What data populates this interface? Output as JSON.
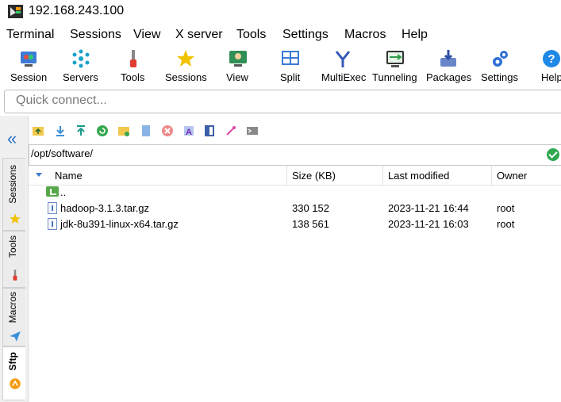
{
  "window": {
    "title": "192.168.243.100"
  },
  "menu": [
    "Terminal",
    "Sessions",
    "View",
    "X server",
    "Tools",
    "Settings",
    "Macros",
    "Help"
  ],
  "toolbar": [
    {
      "label": "Session",
      "icon": "session-icon"
    },
    {
      "label": "Servers",
      "icon": "servers-icon"
    },
    {
      "label": "Tools",
      "icon": "tools-icon"
    },
    {
      "label": "Sessions",
      "icon": "star-icon"
    },
    {
      "label": "View",
      "icon": "view-icon"
    },
    {
      "label": "Split",
      "icon": "split-icon"
    },
    {
      "label": "MultiExec",
      "icon": "multiexec-icon"
    },
    {
      "label": "Tunneling",
      "icon": "tunneling-icon"
    },
    {
      "label": "Packages",
      "icon": "packages-icon"
    },
    {
      "label": "Settings",
      "icon": "settings-icon"
    },
    {
      "label": "Help",
      "icon": "help-icon"
    }
  ],
  "quick_connect": {
    "placeholder": "Quick connect..."
  },
  "side_tabs": [
    {
      "label": "Sessions",
      "icon": "star-icon"
    },
    {
      "label": "Tools",
      "icon": "tools-icon"
    },
    {
      "label": "Macros",
      "icon": "macros-icon"
    },
    {
      "label": "Sftp",
      "icon": "sftp-icon"
    }
  ],
  "sftp": {
    "path": "/opt/software/",
    "columns": {
      "name": "Name",
      "size": "Size (KB)",
      "modified": "Last modified",
      "owner": "Owner"
    },
    "parent_label": "..",
    "files": [
      {
        "name": "hadoop-3.1.3.tar.gz",
        "size": "330 152",
        "modified": "2023-11-21 16:44",
        "owner": "root"
      },
      {
        "name": "jdk-8u391-linux-x64.tar.gz",
        "size": "138 561",
        "modified": "2023-11-21 16:03",
        "owner": "root"
      }
    ]
  }
}
